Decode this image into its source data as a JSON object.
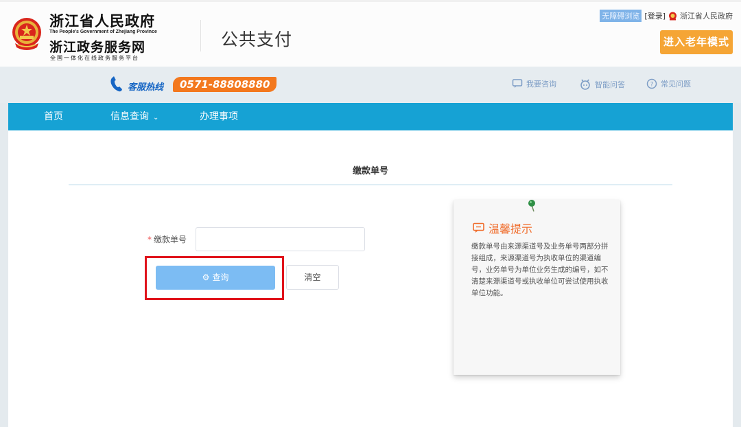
{
  "header": {
    "gov_title": "浙江省人民政府",
    "gov_english": "The People's Government of Zhejiang Province",
    "service_title": "浙江政务服务网",
    "service_subtitle": "全国一体化在线政务服务平台",
    "page_title": "公共支付",
    "accessibility_label": "无障碍浏览",
    "login_label": "[登录]",
    "gov_link_label": "浙江省人民政府",
    "elder_mode_label": "进入老年模式"
  },
  "hotline": {
    "label": "客服热线",
    "number": "0571-88808880",
    "links": [
      "我要咨询",
      "智能问答",
      "常见问题"
    ]
  },
  "nav": {
    "items": [
      "首页",
      "信息查询",
      "办理事项"
    ]
  },
  "form": {
    "section_title": "缴款单号",
    "field_label": "缴款单号",
    "required_mark": "*",
    "field_value": "",
    "query_label": "查询",
    "clear_label": "清空"
  },
  "tip": {
    "title": "温馨提示",
    "body": "缴款单号由来源渠道号及业务单号两部分拼接组成，来源渠道号为执收单位的渠道编号，业务单号为单位业务生成的编号，如不清楚来源渠道号或执收单位可尝试使用执收单位功能。"
  },
  "colors": {
    "nav_bg": "#16a2d4",
    "elder_btn": "#f5a535",
    "hotline_badge": "#f3781e",
    "query_btn": "#7cbcf3",
    "highlight": "#e0141c",
    "tip_title": "#f06d2c"
  },
  "icons": [
    "national-emblem-icon",
    "phone-icon",
    "chat-icon",
    "robot-icon",
    "question-icon",
    "chevron-down-icon",
    "gear-icon",
    "pushpin-icon",
    "message-icon"
  ]
}
